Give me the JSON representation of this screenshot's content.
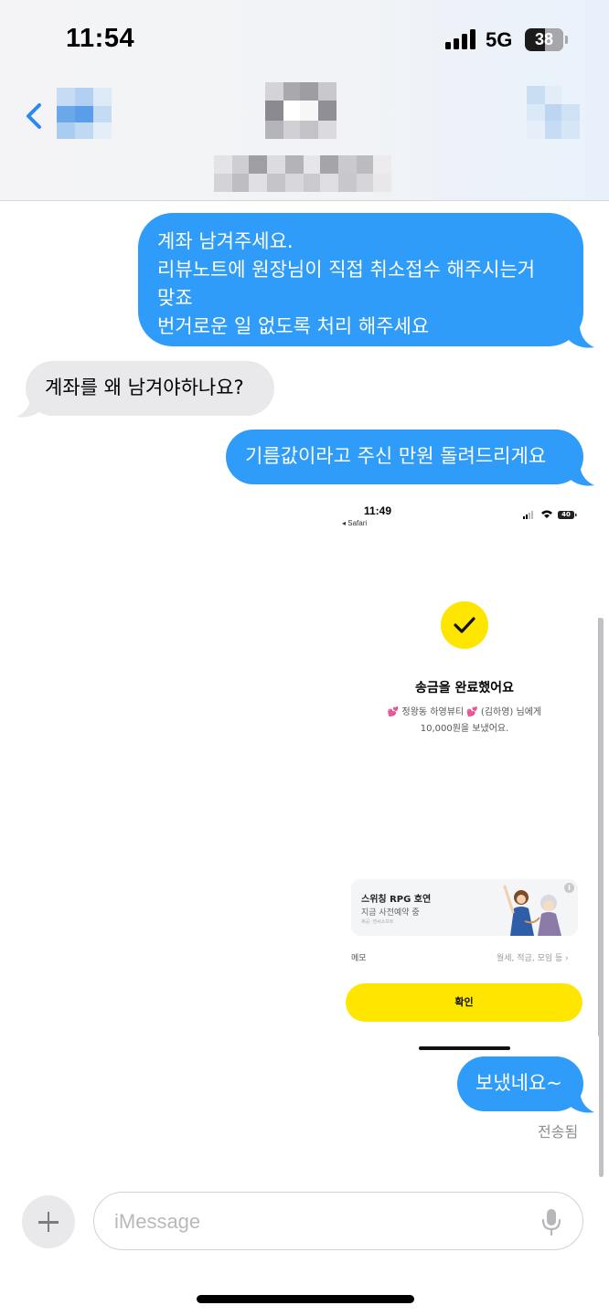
{
  "status_bar": {
    "time": "11:54",
    "network": "5G",
    "battery": "38"
  },
  "conversation": {
    "messages": [
      {
        "direction": "outgoing",
        "lines": [
          "계좌 남겨주세요.",
          "리뷰노트에 원장님이 직접 취소접수 해주시는거",
          "맞죠",
          "번거로운 일 없도록 처리 해주세요"
        ]
      },
      {
        "direction": "incoming",
        "lines": [
          "계좌를 왜 남겨야하나요?"
        ]
      },
      {
        "direction": "outgoing",
        "lines": [
          "기름값이라고 주신 만원 돌려드리게요"
        ]
      },
      {
        "direction": "outgoing",
        "lines": [
          "보냈네요~"
        ]
      }
    ],
    "delivered_label": "전송됨"
  },
  "attachment": {
    "status_time": "11:49",
    "status_back": "◂ Safari",
    "status_battery": "40",
    "title": "송금을 완료했어요",
    "recipient_line": "💕 정왕동 하영뷰티 💕 (김하영) 님에게",
    "amount_line": "10,000원을 보냈어요.",
    "ad": {
      "title": "스위칭 RPG 호연",
      "subtitle": "지금 사전예약 중",
      "tiny": "제공: 엔씨소프트",
      "info": "i"
    },
    "memo_label": "메모",
    "memo_hint": "월세, 적금, 모임 등 ›",
    "confirm_label": "확인"
  },
  "composer": {
    "placeholder": "iMessage"
  },
  "colors": {
    "outgoing_bubble": "#2e9cf8",
    "incoming_bubble": "#e9e9eb",
    "accent_yellow": "#ffe600",
    "ios_blue": "#2f88f0"
  },
  "icons": [
    "back-chevron-icon",
    "signal-icon",
    "battery-icon",
    "plus-icon",
    "microphone-icon",
    "checkmark-icon",
    "wifi-icon"
  ]
}
